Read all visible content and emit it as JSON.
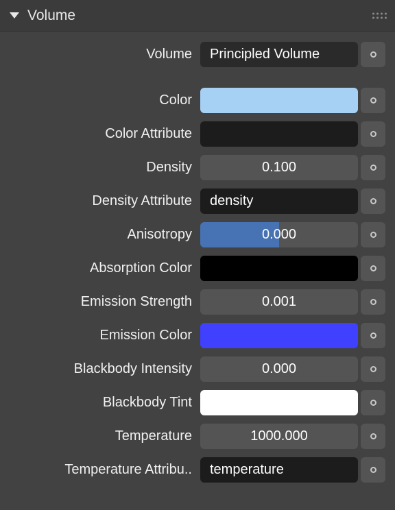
{
  "header": {
    "title": "Volume"
  },
  "rows": {
    "volume": {
      "label": "Volume",
      "value": "Principled Volume",
      "type": "dropdown"
    },
    "color": {
      "label": "Color",
      "type": "swatch",
      "color": "#a7d0f5"
    },
    "colorAttr": {
      "label": "Color Attribute",
      "type": "text",
      "value": ""
    },
    "density": {
      "label": "Density",
      "type": "slider",
      "value": "0.100",
      "fill": 0
    },
    "densityAttr": {
      "label": "Density Attribute",
      "type": "text",
      "value": "density"
    },
    "anisotropy": {
      "label": "Anisotropy",
      "type": "slider",
      "value": "0.000",
      "fill": 50
    },
    "absorption": {
      "label": "Absorption Color",
      "type": "swatch",
      "color": "#000000"
    },
    "emissionStrength": {
      "label": "Emission Strength",
      "type": "slider",
      "value": "0.001",
      "fill": 0
    },
    "emissionColor": {
      "label": "Emission Color",
      "type": "swatch",
      "color": "#4040ff"
    },
    "blackbodyIntensity": {
      "label": "Blackbody Intensity",
      "type": "slider",
      "value": "0.000",
      "fill": 0
    },
    "blackbodyTint": {
      "label": "Blackbody Tint",
      "type": "swatch",
      "color": "#ffffff"
    },
    "temperature": {
      "label": "Temperature",
      "type": "slider",
      "value": "1000.000",
      "fill": 0
    },
    "temperatureAttr": {
      "label": "Temperature Attribu..",
      "type": "text",
      "value": "temperature"
    }
  }
}
